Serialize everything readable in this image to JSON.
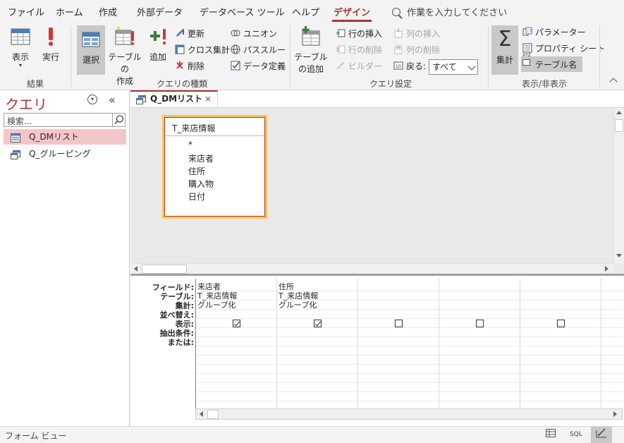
{
  "menu": {
    "tabs": [
      "ファイル",
      "ホーム",
      "作成",
      "外部データ",
      "データベース ツール",
      "ヘルプ",
      "デザイン"
    ],
    "active": "デザイン",
    "tell_me": "作業を入力してください"
  },
  "ribbon": {
    "groups": {
      "results": "結果",
      "query_type": "クエリの種類",
      "query_setup": "クエリ設定",
      "show_hide": "表示/非表示"
    },
    "buttons": {
      "view": "表示",
      "run": "実行",
      "select": "選択",
      "make_table_1": "テーブルの",
      "make_table_2": "作成",
      "append": "追加",
      "update": "更新",
      "crosstab": "クロス集計",
      "delete": "削除",
      "union": "ユニオン",
      "passthrough": "パススルー",
      "data_definition": "データ定義",
      "show_table_1": "テーブル",
      "show_table_2": "の追加",
      "insert_rows": "行の挿入",
      "delete_rows": "行の削除",
      "builder": "ビルダー",
      "insert_columns": "列の挿入",
      "delete_columns": "列の削除",
      "return_label": "戻る:",
      "return_value": "すべて",
      "totals": "集計",
      "parameters": "パラメーター",
      "property_sheet": "プロパティ シート",
      "table_names": "テーブル名",
      "table_names_small": "XYZ"
    }
  },
  "nav": {
    "title": "クエリ",
    "search_placeholder": "検索...",
    "items": [
      "Q_DMリスト",
      "Q_グルーピング"
    ]
  },
  "document": {
    "tab_label": "Q_DMリスト",
    "close_glyph": "×",
    "table": {
      "name": "T_来店情報",
      "fields": [
        "*",
        "来店者",
        "住所",
        "購入物",
        "日付"
      ]
    },
    "grid": {
      "row_labels": [
        "フィールド:",
        "テーブル:",
        "集計:",
        "並べ替え:",
        "表示:",
        "抽出条件:",
        "または:"
      ],
      "columns": [
        {
          "field": "来店者",
          "table": "T_来店情報",
          "total": "グループ化",
          "show": true
        },
        {
          "field": "住所",
          "table": "T_来店情報",
          "total": "グループ化",
          "show": true
        },
        {
          "field": "",
          "table": "",
          "total": "",
          "show": false
        },
        {
          "field": "",
          "table": "",
          "total": "",
          "show": false
        },
        {
          "field": "",
          "table": "",
          "total": "",
          "show": false
        }
      ]
    }
  },
  "status": {
    "text": "フォーム ビュー",
    "sql_label": "SQL"
  },
  "colors": {
    "accent": "#a4373a",
    "selection": "#f5c6c8",
    "field_list_border": "#f7c64e"
  }
}
